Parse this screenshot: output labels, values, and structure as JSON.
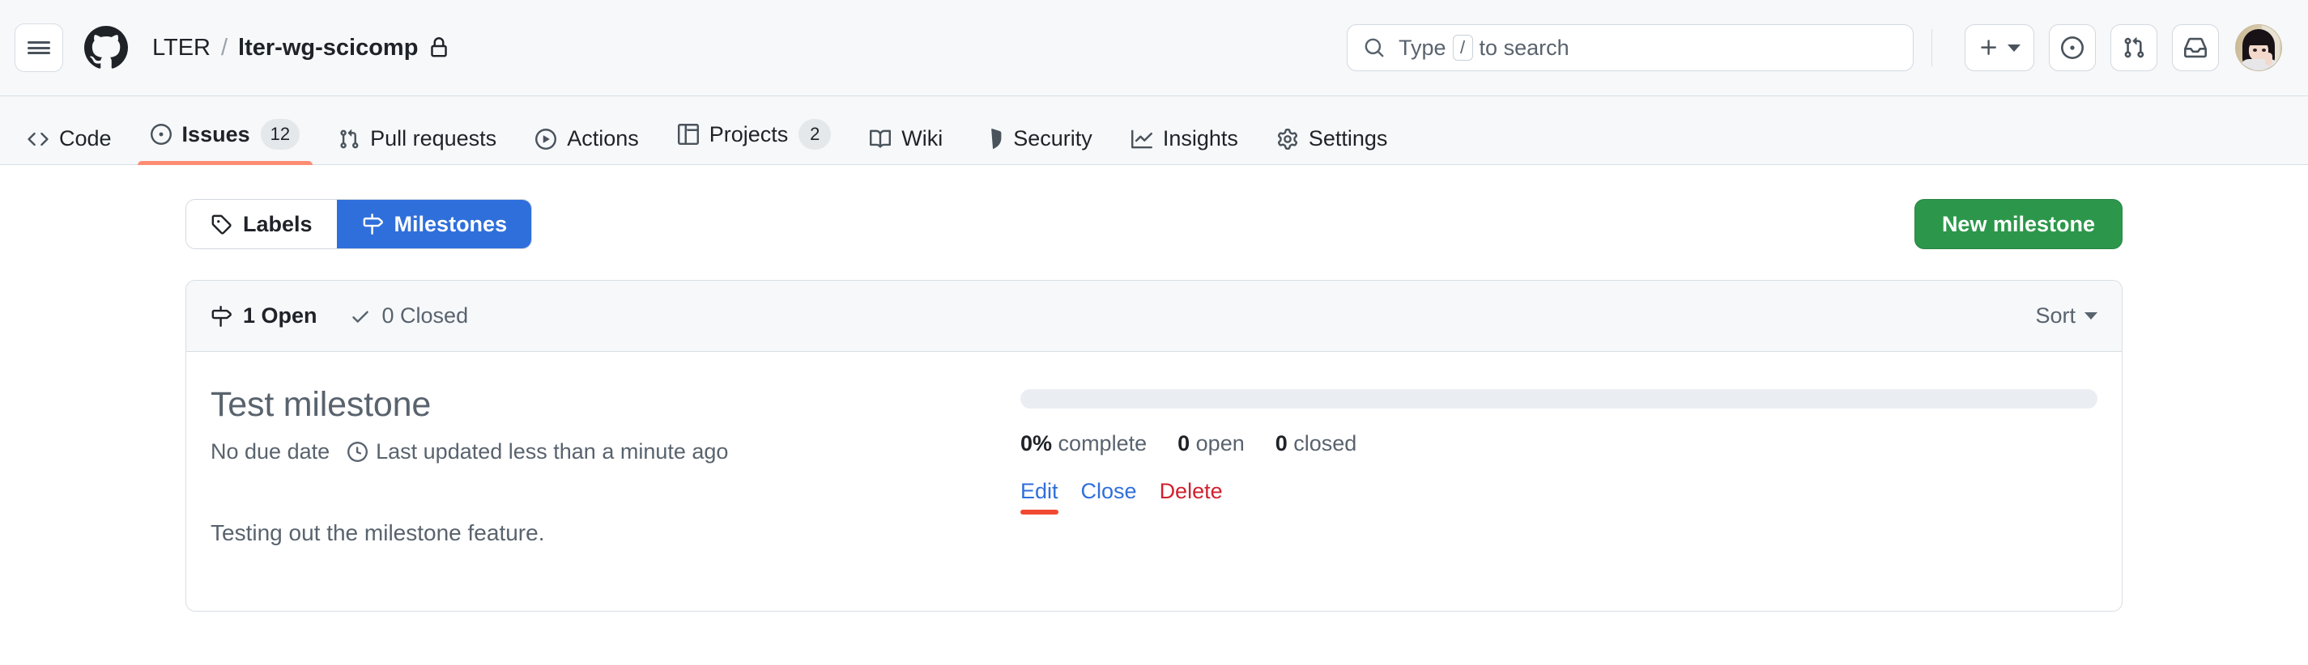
{
  "header": {
    "menu_icon": "hamburger-icon",
    "logo_icon": "github-logo-icon",
    "owner": "LTER",
    "separator": "/",
    "repo": "lter-wg-scicomp",
    "visibility_icon": "lock-icon",
    "search": {
      "placeholder_prefix": "Type",
      "shortcut_key": "/",
      "placeholder_suffix": "to search",
      "icon": "search-icon"
    },
    "actions": [
      {
        "name": "create-new-menu",
        "icon": "plus-icon",
        "has_caret": true
      },
      {
        "name": "issues-button",
        "icon": "issue-opened-icon"
      },
      {
        "name": "pull-requests-button",
        "icon": "git-pull-request-icon"
      },
      {
        "name": "notifications-button",
        "icon": "inbox-icon"
      }
    ],
    "avatar": "user-avatar"
  },
  "repo_nav": {
    "items": [
      {
        "label": "Code",
        "icon": "code-icon",
        "count": null,
        "active": false
      },
      {
        "label": "Issues",
        "icon": "issue-opened-icon",
        "count": "12",
        "active": true
      },
      {
        "label": "Pull requests",
        "icon": "git-pull-request-icon",
        "count": null,
        "active": false
      },
      {
        "label": "Actions",
        "icon": "play-icon",
        "count": null,
        "active": false
      },
      {
        "label": "Projects",
        "icon": "table-icon",
        "count": "2",
        "active": false
      },
      {
        "label": "Wiki",
        "icon": "book-icon",
        "count": null,
        "active": false
      },
      {
        "label": "Security",
        "icon": "shield-icon",
        "count": null,
        "active": false
      },
      {
        "label": "Insights",
        "icon": "graph-icon",
        "count": null,
        "active": false
      },
      {
        "label": "Settings",
        "icon": "gear-icon",
        "count": null,
        "active": false
      }
    ]
  },
  "subnav": {
    "labels_tab": "Labels",
    "labels_icon": "tag-icon",
    "milestones_tab": "Milestones",
    "milestones_icon": "milestone-icon",
    "new_milestone_button": "New milestone"
  },
  "milestone_list": {
    "open_count_label": "1 Open",
    "open_icon": "milestone-icon",
    "closed_count_label": "0 Closed",
    "closed_icon": "check-icon",
    "sort_label": "Sort",
    "sort_caret_icon": "chevron-down-icon"
  },
  "milestone": {
    "title": "Test milestone",
    "due_date": "No due date",
    "updated_icon": "clock-icon",
    "updated": "Last updated less than a minute ago",
    "description": "Testing out the milestone feature.",
    "progress_percent": 0,
    "percent_complete_value": "0%",
    "percent_complete_label": "complete",
    "open_value": "0",
    "open_label": "open",
    "closed_value": "0",
    "closed_label": "closed",
    "edit_action": "Edit",
    "close_action": "Close",
    "delete_action": "Delete"
  },
  "colors": {
    "accent_blue": "#2f6fdb",
    "success_green": "#2c974b",
    "danger_red": "#cf222e",
    "active_tab_underline": "#fd8c73",
    "cursor_marker": "#f04a33",
    "canvas_subtle": "#f6f8fa",
    "border": "#d8dee4"
  }
}
